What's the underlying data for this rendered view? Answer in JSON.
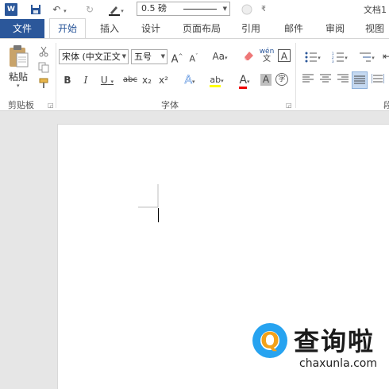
{
  "quick_access": {
    "app_icon": "W",
    "line_weight": "0.5 磅",
    "title": "文档1"
  },
  "tabs": {
    "file": "文件",
    "items": [
      "开始",
      "插入",
      "设计",
      "页面布局",
      "引用",
      "邮件",
      "审阅",
      "视图"
    ],
    "active": "开始"
  },
  "ribbon": {
    "clipboard": {
      "paste_label": "粘贴",
      "group_label": "剪贴板"
    },
    "font": {
      "font_name": "宋体 (中文正文",
      "font_size": "五号",
      "grow_label": "A",
      "shrink_label": "A",
      "case_label": "Aa",
      "phonetic_label": "wén",
      "border_char_label": "A",
      "bold": "B",
      "italic": "I",
      "underline": "U",
      "strike": "abc",
      "subscript": "x₂",
      "superscript": "x²",
      "text_effect": "A",
      "highlight": "ab",
      "font_color": "A",
      "char_shading": "A",
      "enclose_char": "字",
      "group_label": "字体"
    },
    "paragraph": {
      "group_label": "段"
    }
  },
  "watermark": {
    "brand_cn": "查询啦",
    "url": "chaxunla.com"
  },
  "colors": {
    "accent": "#2b579a",
    "watermark_blue": "#27a3f0",
    "watermark_orange": "#f3a21a"
  }
}
